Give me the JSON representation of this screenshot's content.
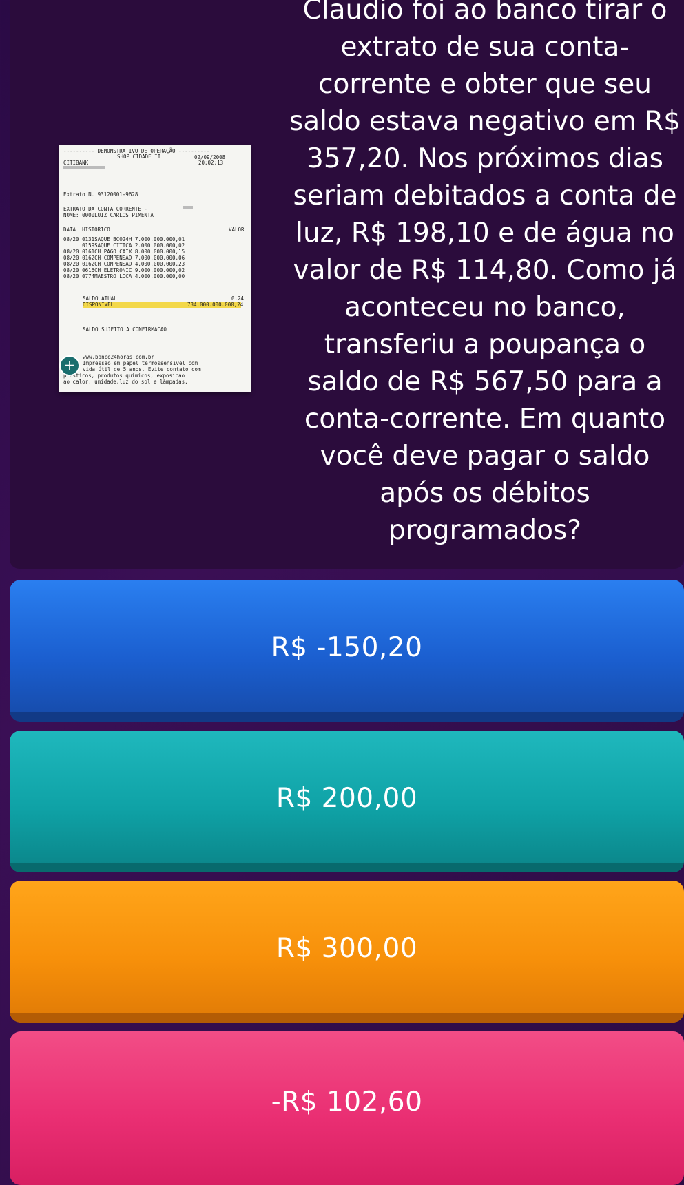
{
  "question": {
    "text_lines": [
      "Claudio foi ao banco tirar o",
      "extrato de sua conta-",
      "corrente e obter que seu",
      "saldo estava negativo em R$",
      "357,20. Nos próximos dias",
      "seriam debitados a conta de",
      "luz, R$ 198,10 e de água no",
      "valor de R$ 114,80. Como já",
      "aconteceu no banco,",
      "transferiu a poupança o",
      "saldo de R$ 567,50 para a",
      "conta-corrente. Em quanto",
      "você deve pagar o saldo",
      "após os débitos",
      "programados?"
    ]
  },
  "receipt": {
    "header": "---------- DEMONSTRATIVO DE OPERAÇÃO ----------",
    "bank": "CITIBANK",
    "shop": "SHOP CIDADE II",
    "date": "02/09/2008",
    "time": "20:02:13",
    "extrato": "Extrato N. 93120001-9628",
    "title": "EXTRATO DA CONTA CORRENTE -",
    "nome": "NOME: 0000LUIZ CARLOS PIMENTA",
    "col_data": "DATA  HISTORICO",
    "col_valor": "VALOR",
    "rows": [
      "08/20 0131SAQUE BCO24H 7.000.000.000,01",
      "      0159SAQUE CITICA 2.000.000.000,02",
      "08/20 0161CH PAGO CAIX 8.000.000.000,15",
      "08/20 0162CH COMPENSAD 7.000.000.000,06",
      "08/20 0162CH COMPENSAD 4.000.000.000,23",
      "08/20 0616CH ELETRONIC 9.000.000.000,02",
      "08/20 0774MAESTRO LOCA 4.000.000.000,00"
    ],
    "saldo_atual_label": "SALDO ATUAL",
    "saldo_atual_value": "0,24",
    "disponivel_label": "DISPONIVEL",
    "disponivel_value": "734.000.000.000,24",
    "saldo_sujeito": "SALDO SUJEITO A CONFIRMACAO",
    "footer": [
      "www.banco24horas.com.br",
      "Impressao em papel termossensivel com",
      "vida útil de 5 anos. Evite contato com",
      "plásticos, produtos químicos, exposicao",
      "ao calor, umidade,luz do sol e lâmpadas."
    ]
  },
  "zoom_icon": "zoom-in-icon",
  "answers": [
    {
      "label": "R$ -150,20",
      "color": "#1b5fd0"
    },
    {
      "label": "R$ 200,00",
      "color": "#0fa2a6"
    },
    {
      "label": "R$ 300,00",
      "color": "#f7900a"
    },
    {
      "label": "-R$ 102,60",
      "color": "#ea2f73"
    }
  ]
}
